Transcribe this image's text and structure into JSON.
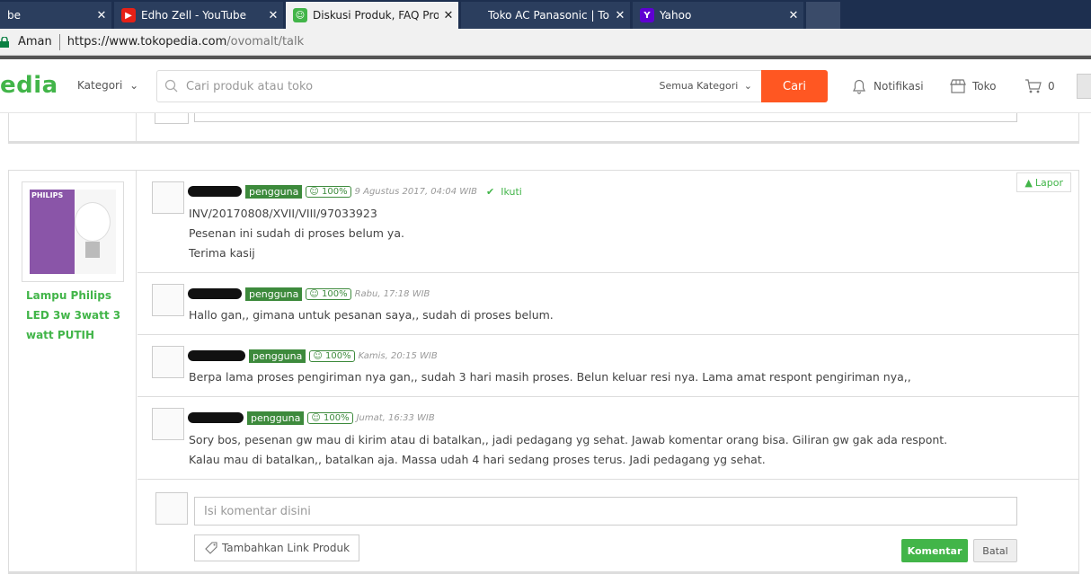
{
  "browser": {
    "tabs": [
      {
        "label": "be",
        "active": false,
        "icon": ""
      },
      {
        "label": "Edho Zell - YouTube",
        "active": false,
        "icon": "youtube-icon"
      },
      {
        "label": "Diskusi Produk, FAQ Pro",
        "active": true,
        "icon": "tokopedia-icon"
      },
      {
        "label": "Toko AC Panasonic | Tok",
        "active": false,
        "icon": ""
      },
      {
        "label": "Yahoo",
        "active": false,
        "icon": "yahoo-icon"
      }
    ],
    "secure_label": "Aman",
    "url_host": "https://www.tokopedia.com",
    "url_path": "/ovomalt/talk"
  },
  "header": {
    "logo_text": "edia",
    "kategori_label": "Kategori",
    "search_placeholder": "Cari produk atau toko",
    "category_select": "Semua Kategori",
    "search_button": "Cari",
    "notifikasi_label": "Notifikasi",
    "toko_label": "Toko",
    "cart_count": "0",
    "accent_color": "#42b549",
    "search_button_color": "#ff5722"
  },
  "product": {
    "name": "Lampu Philips LED 3w 3watt 3 watt PUTIH",
    "image_brand": "PHILIPS"
  },
  "lapor_label": "Lapor",
  "messages": [
    {
      "role": "pengguna",
      "reputation": "100%",
      "time": "9 Agustus 2017, 04:04 WIB",
      "follow_label": "Ikuti",
      "lines": [
        "INV/20170808/XVII/VIII/97033923",
        "Pesenan ini sudah di proses belum ya.",
        "Terima kasij"
      ]
    },
    {
      "role": "pengguna",
      "reputation": "100%",
      "time": "Rabu, 17:18 WIB",
      "lines": [
        "Hallo gan,, gimana untuk pesanan saya,, sudah di proses belum."
      ]
    },
    {
      "role": "pengguna",
      "reputation": "100%",
      "time": "Kamis, 20:15 WIB",
      "lines": [
        "Berpa lama proses pengiriman nya gan,, sudah 3 hari masih proses. Belun keluar resi nya. Lama amat respont pengiriman nya,,"
      ]
    },
    {
      "role": "pengguna",
      "reputation": "100%",
      "time": "Jumat, 16:33 WIB",
      "lines": [
        "Sory bos, pesenan gw mau di kirim atau di batalkan,, jadi pedagang yg sehat. Jawab komentar orang bisa. Giliran gw gak ada respont.",
        "Kalau mau di batalkan,, batalkan aja. Massa udah 4 hari sedang proses terus. Jadi pedagang yg sehat."
      ]
    }
  ],
  "reply": {
    "placeholder": "Isi komentar disini",
    "add_link_label": "Tambahkan Link Produk",
    "submit_label": "Komentar",
    "cancel_label": "Batal"
  }
}
